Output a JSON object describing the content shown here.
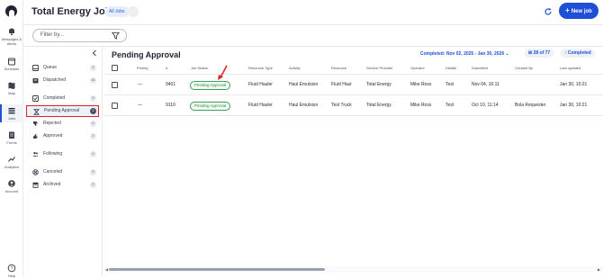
{
  "app": {
    "title": "Total Energy Jobs",
    "filter_chip": "All Jobs"
  },
  "rail": {
    "items": [
      {
        "label": "Messages & Alerts"
      },
      {
        "label": "Schedule"
      },
      {
        "label": "Map"
      },
      {
        "label": "Jobs"
      },
      {
        "label": "Forms"
      },
      {
        "label": "Analytics"
      },
      {
        "label": "Account"
      },
      {
        "label": "Help"
      }
    ]
  },
  "header": {
    "new_job_label": "New job",
    "new_job_plus": "+"
  },
  "filter": {
    "placeholder": "Filter by..."
  },
  "statuses": [
    {
      "label": "Queue",
      "count": "2"
    },
    {
      "label": "Dispatched",
      "count": "14"
    },
    {
      "label": "Completed",
      "count": "0"
    },
    {
      "label": "Pending Approval",
      "count": "2"
    },
    {
      "label": "Rejected",
      "count": "0"
    },
    {
      "label": "Approved",
      "count": "2"
    },
    {
      "label": "Following",
      "count": "0"
    },
    {
      "label": "Canceled",
      "count": "0"
    },
    {
      "label": "Archived",
      "count": "0"
    }
  ],
  "main": {
    "title": "Pending Approval",
    "date_range": "Completed: Nov 02, 2025 - Jan 30, 2026 ⌄",
    "result_count": "28 of 77",
    "sort_label": "↑ Completed"
  },
  "table": {
    "columns": [
      "Priority",
      "#",
      "Job Status",
      "Resource Type",
      "Activity",
      "Resource",
      "Service Provider",
      "Operator",
      "Details",
      "Submitted",
      "Created By",
      "Last updated"
    ],
    "rows": [
      {
        "priority": "—",
        "id": "9401",
        "status": "Pending Approval",
        "resource_type": "Fluid Hauler",
        "activity": "Haul Emulsion",
        "resource": "Fluid Haul",
        "provider": "Total Energy",
        "operator": "Mike Ross",
        "details": "Test",
        "submitted": "Nov 04, 16:11",
        "created_by": "",
        "updated": "Jan 30, 10:21"
      },
      {
        "priority": "—",
        "id": "9110",
        "status": "Pending Approval",
        "resource_type": "Fluid Hauler",
        "activity": "Haul Emulsion",
        "resource": "Test Truck",
        "provider": "Total Energy",
        "operator": "Mike Ross",
        "details": "Test",
        "submitted": "Oct 10, 11:14",
        "created_by": "Bola Requester",
        "updated": "Jan 30, 10:21"
      }
    ]
  },
  "colors": {
    "accent": "#1f4fd6",
    "highlight": "#d7262b",
    "success": "#3fa05a"
  }
}
